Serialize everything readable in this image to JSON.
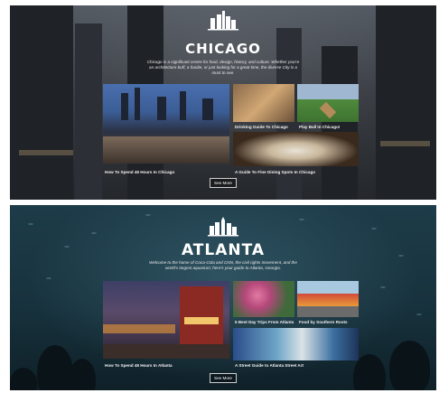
{
  "sections": [
    {
      "city": "CHICAGO",
      "description": "Chicago is a significant centre for food, design, history, and culture. Whether you're an architecture buff, a foodie, or just looking for a great time, the diverse City is a must to see.",
      "cards": [
        {
          "caption": "How To Spend 48 Hours In Chicago"
        },
        {
          "caption": "Drinking Guide To Chicago"
        },
        {
          "caption": "Play Ball In Chicago!"
        },
        {
          "caption": "A Guide To Fine Dining Spots In Chicago"
        }
      ],
      "button_label": "See More"
    },
    {
      "city": "ATLANTA",
      "description": "Welcome to the home of Coca-Cola and CNN, the civil rights movement, and the world's largest aquarium; here's your guide to Atlanta, Georgia.",
      "cards": [
        {
          "caption": "How To Spend 48 Hours In Atlanta"
        },
        {
          "caption": "5 Best Day Trips From Atlanta"
        },
        {
          "caption": "Food by Southern Roots"
        },
        {
          "caption": "A Street Guide to Atlanta Street Art"
        }
      ],
      "button_label": "See More"
    }
  ],
  "colors": {
    "chicago_bg": "#3a3e44",
    "atlanta_bg": "#17323d",
    "text": "#ffffff"
  }
}
